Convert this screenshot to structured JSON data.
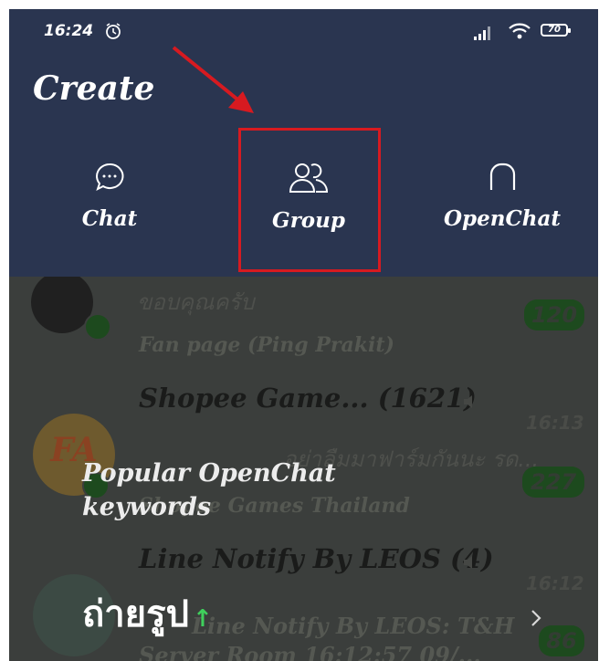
{
  "status_bar": {
    "time": "16:24",
    "battery": "70"
  },
  "header": {
    "title": "Create",
    "options": [
      {
        "label": "Chat",
        "icon": "chat-bubble-icon"
      },
      {
        "label": "Group",
        "icon": "group-people-icon"
      },
      {
        "label": "OpenChat",
        "icon": "openchat-icon"
      }
    ],
    "highlighted": "Group",
    "highlight_color": "#d71a20",
    "background_color": "#2a3550"
  },
  "list": {
    "items": [
      {
        "preview": "ขอบคุณครับ",
        "sender": "Fan page (Ping Prakit)",
        "badge": "120"
      },
      {
        "name": "Shopee Game...",
        "count": "(1621)",
        "time": "16:13",
        "preview": "อย่าลืมมาฟาร์มกันนะ รด...",
        "sender": "Shopee Games Thailand",
        "badge": "227"
      },
      {
        "name": "Line Notify By LEOS",
        "count": "(4)",
        "time": "16:12",
        "preview": "Line Notify By LEOS: T&H",
        "preview2": "Server Room 16:12:57 09/...",
        "badge": "86"
      }
    ],
    "avatar_text": "FA"
  },
  "popular": {
    "heading": "Popular OpenChat keywords",
    "keyword": "ถ่ายรูป",
    "trend": "↑"
  }
}
